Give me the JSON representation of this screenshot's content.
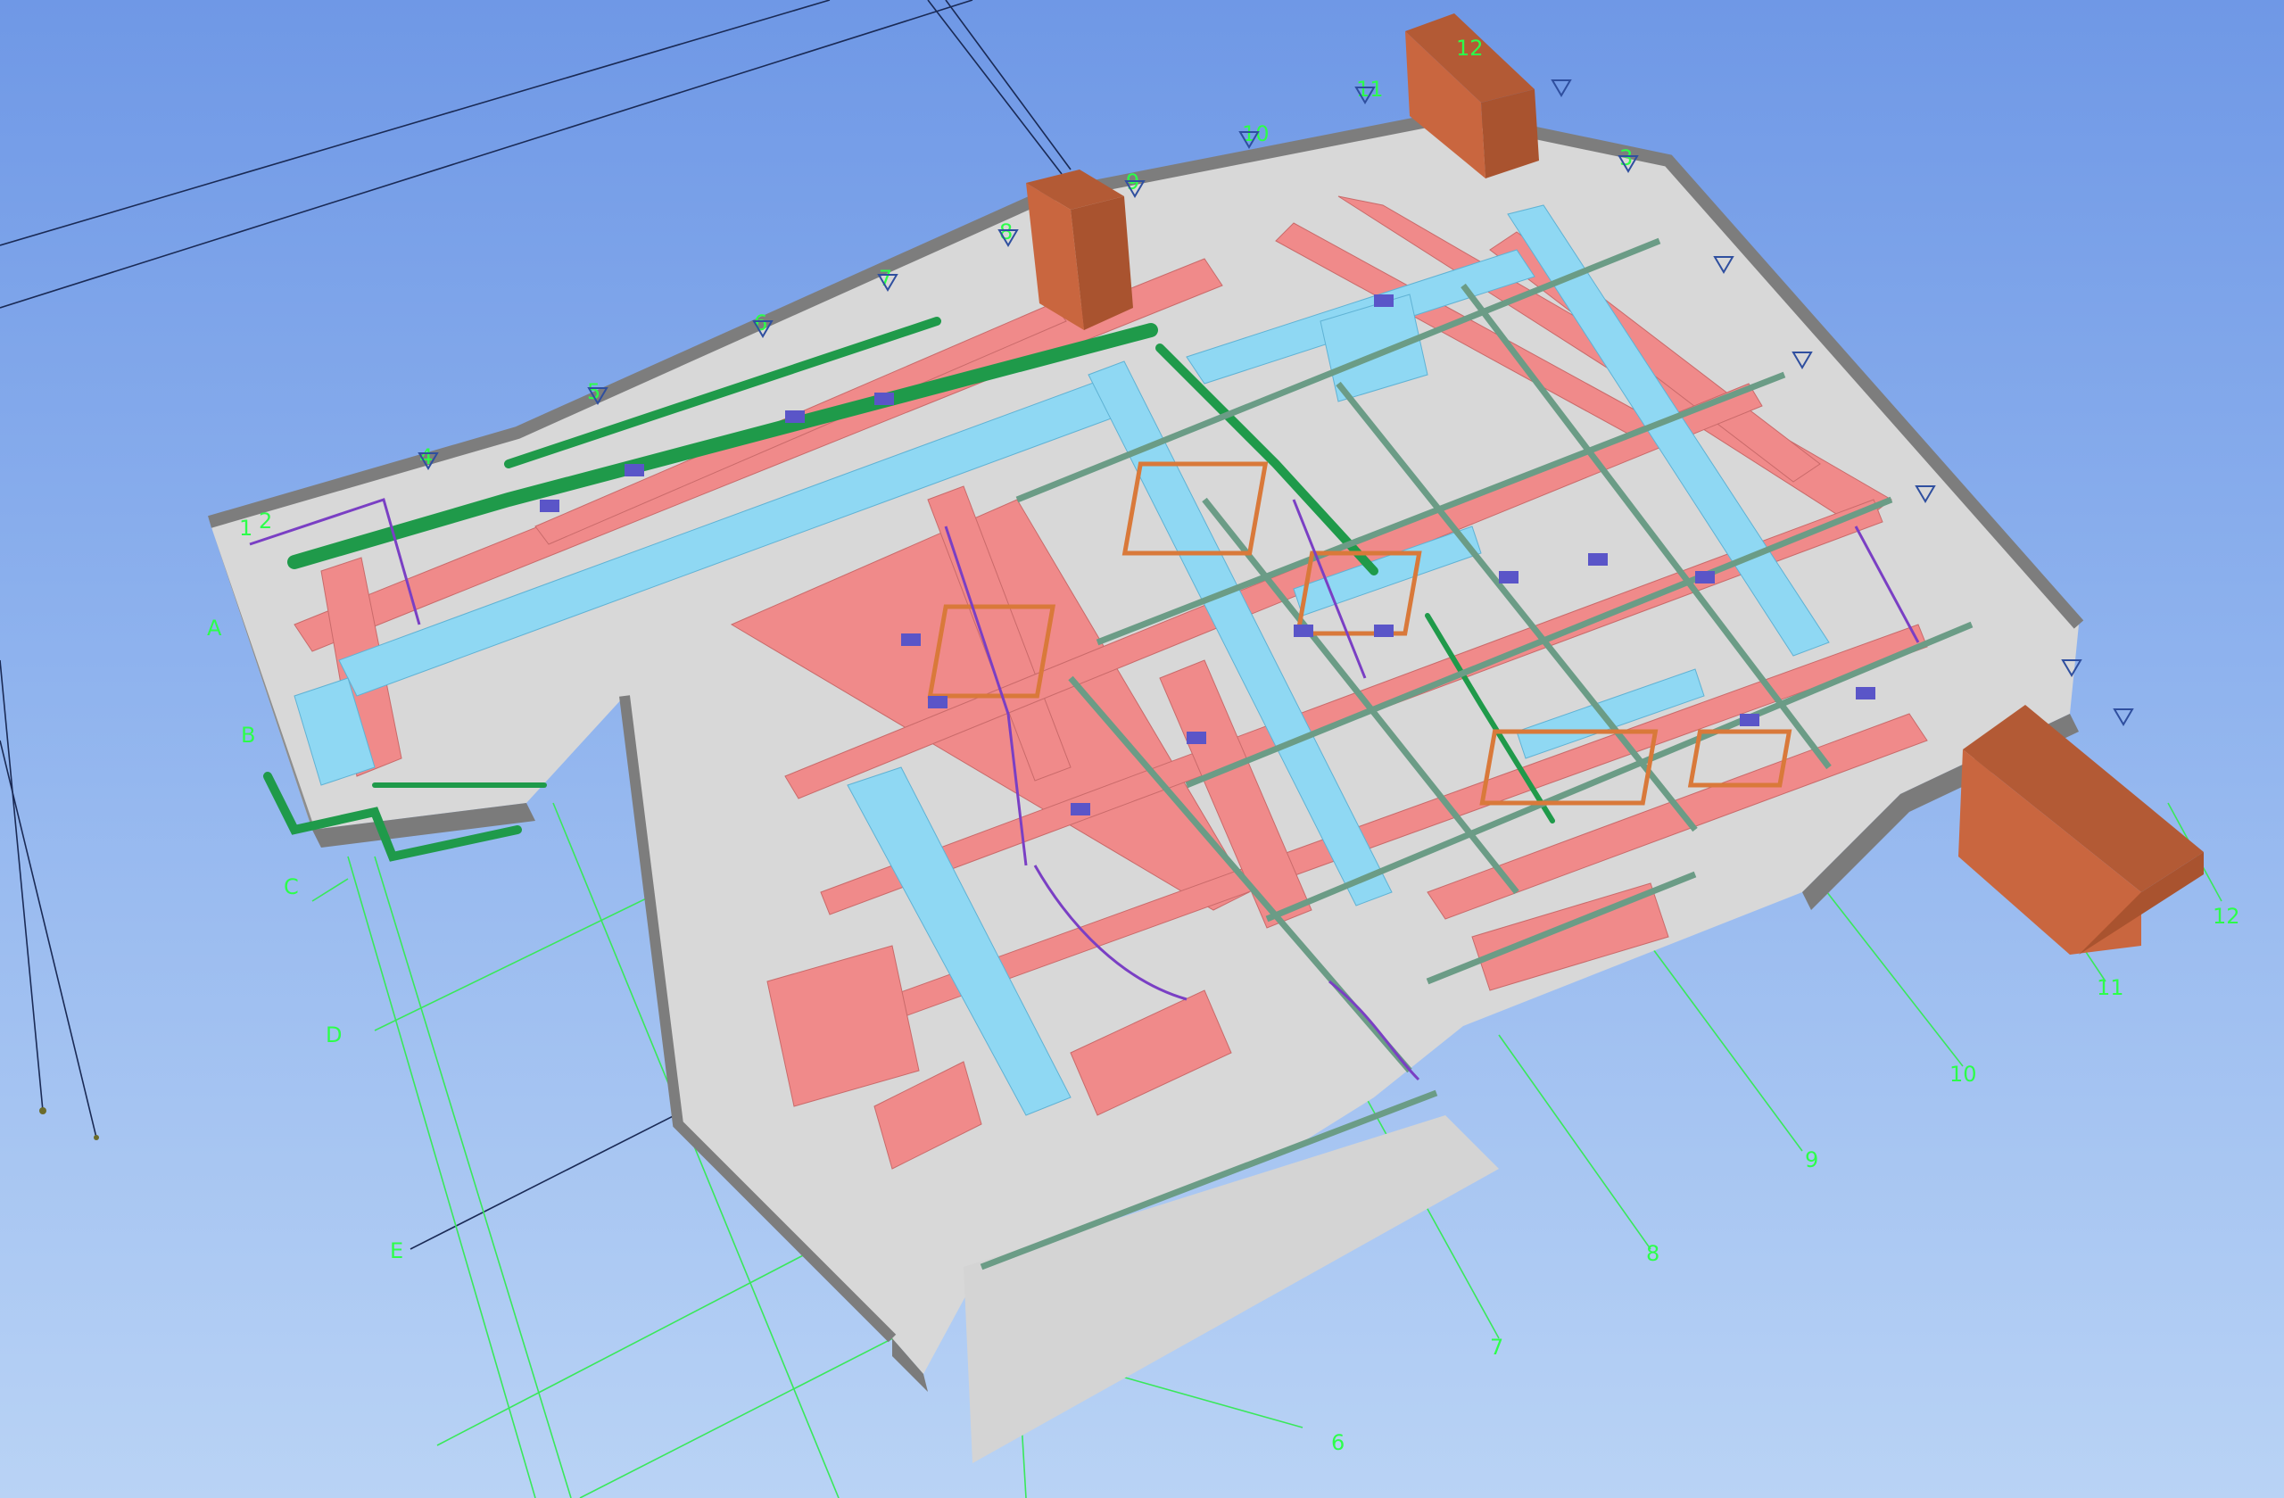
{
  "colors": {
    "background_top": "#6f98e6",
    "background_bottom": "#b9d3f5",
    "grid": "#39e85a",
    "grid_label": "#2cff4a",
    "slab": "#dcdcdc",
    "wall": "#8e8e8e",
    "supply_duct": "#f08a8a",
    "return_duct": "#8fd8f3",
    "green_pipe": "#1f9a4a",
    "chimney": "#c9663f",
    "purple_pipe": "#7a3fc4",
    "orange_frame": "#d9793a"
  },
  "grid_labels": {
    "rows": [
      "A",
      "B",
      "C",
      "D",
      "E"
    ],
    "columns_bottom": [
      "6",
      "7",
      "8",
      "9",
      "10",
      "11",
      "12"
    ],
    "top_row": [
      "1",
      "2",
      "12",
      "11",
      "10",
      "9",
      "8",
      "7",
      "6",
      "5",
      "4",
      "3"
    ]
  },
  "model": {
    "description": "3D isometric MEP coordination model – floor plate with HVAC ducts and piping"
  }
}
